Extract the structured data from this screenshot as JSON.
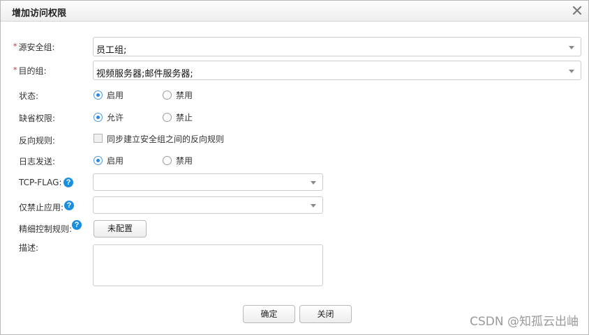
{
  "dialog": {
    "title": "增加访问权限"
  },
  "form": {
    "source_group": {
      "label": "源安全组:",
      "value": "员工组;"
    },
    "dest_group": {
      "label": "目的组:",
      "value": "视频服务器;邮件服务器;"
    },
    "status": {
      "label": "状态:",
      "options": [
        "启用",
        "禁用"
      ],
      "selected": "启用"
    },
    "default_permission": {
      "label": "缺省权限:",
      "options": [
        "允许",
        "禁止"
      ],
      "selected": "允许"
    },
    "reverse_rule": {
      "label": "反向规则:",
      "checkbox_label": "同步建立安全组之间的反向规则",
      "checked": false
    },
    "log_send": {
      "label": "日志发送:",
      "options": [
        "启用",
        "禁用"
      ],
      "selected": "启用"
    },
    "tcp_flag": {
      "label": "TCP-FLAG:",
      "value": ""
    },
    "deny_app": {
      "label": "仅禁止应用:",
      "value": ""
    },
    "fine_control": {
      "label": "精细控制规则:",
      "button_label": "未配置"
    },
    "description": {
      "label": "描述:",
      "value": ""
    }
  },
  "footer": {
    "ok_label": "确定",
    "close_label": "关闭"
  },
  "watermark": "CSDN @知孤云出岫",
  "colors": {
    "accent": "#2f86d8",
    "required": "#e02020",
    "help": "#1a8fe0"
  }
}
